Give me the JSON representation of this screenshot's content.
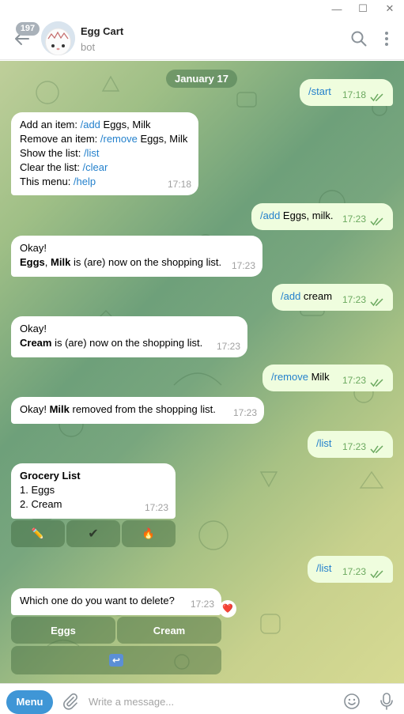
{
  "window": {
    "minimize_glyph": "—",
    "maximize_glyph": "☐",
    "close_glyph": "✕"
  },
  "header": {
    "unread_count": "197",
    "title": "Egg Cart",
    "subtitle": "bot",
    "icons": [
      "back-arrow-icon",
      "search-icon",
      "more-vertical-icon"
    ]
  },
  "chat": {
    "date": "January 17",
    "messages": [
      {
        "id": "m1",
        "dir": "out",
        "parts": [
          {
            "cmd": "/start"
          }
        ],
        "time": "17:18",
        "read": true
      },
      {
        "id": "m2",
        "dir": "in",
        "lines": [
          {
            "text": "Add an item: ",
            "cmd": "/add",
            "rest": " Eggs, Milk"
          },
          {
            "text": "Remove an item: ",
            "cmd": "/remove",
            "rest": " Eggs, Milk"
          },
          {
            "text": "Show the list: ",
            "cmd": "/list",
            "rest": ""
          },
          {
            "text": "Clear the list: ",
            "cmd": "/clear",
            "rest": ""
          },
          {
            "text": "This menu: ",
            "cmd": "/help",
            "rest": ""
          }
        ],
        "time": "17:18"
      },
      {
        "id": "m3",
        "dir": "out",
        "cmd": "/add",
        "rest": " Eggs, milk.",
        "time": "17:23",
        "read": true
      },
      {
        "id": "m4",
        "dir": "in",
        "line1": "Okay!",
        "bold1": "Eggs",
        "sep": ", ",
        "bold2": "Milk",
        "rest": " is (are) now on the shopping list.",
        "time": "17:23"
      },
      {
        "id": "m5",
        "dir": "out",
        "cmd": "/add",
        "rest": " cream",
        "time": "17:23",
        "read": true
      },
      {
        "id": "m6",
        "dir": "in",
        "line1": "Okay!",
        "bold1": "Cream",
        "rest": " is (are) now on the shopping list.",
        "time": "17:23"
      },
      {
        "id": "m7",
        "dir": "out",
        "cmd": "/remove",
        "rest": " Milk",
        "time": "17:23",
        "read": true
      },
      {
        "id": "m8",
        "dir": "in",
        "pre": "Okay! ",
        "bold1": "Milk",
        "rest": " removed from the shopping list.",
        "time": "17:23"
      },
      {
        "id": "m9",
        "dir": "out",
        "cmd": "/list",
        "time": "17:23",
        "read": true
      },
      {
        "id": "m10",
        "dir": "in",
        "heading": "Grocery List",
        "items": [
          "1. Eggs",
          "2. Cream"
        ],
        "time": "17:23",
        "buttons": [
          {
            "label": "✏️",
            "icon": "pencil-icon"
          },
          {
            "label": "✔",
            "icon": "checkmark-icon"
          },
          {
            "label": "🔥",
            "icon": "fire-icon"
          }
        ]
      },
      {
        "id": "m11",
        "dir": "out",
        "cmd": "/list",
        "time": "17:23",
        "read": true
      },
      {
        "id": "m12",
        "dir": "in",
        "text": "Which one do you want to delete?",
        "time": "17:23",
        "reaction": "❤️",
        "buttons": [
          {
            "label": "Eggs"
          },
          {
            "label": "Cream"
          },
          {
            "label": "↩",
            "icon": "return-arrow-icon"
          }
        ]
      }
    ]
  },
  "input": {
    "menu_label": "Menu",
    "placeholder": "Write a message...",
    "icons": [
      "attach-icon",
      "emoji-icon",
      "microphone-icon"
    ]
  },
  "colors": {
    "accent": "#3f96d6",
    "link": "#2481cc",
    "outgoing_bubble": "#effdde",
    "read_check": "#6ba95f"
  }
}
